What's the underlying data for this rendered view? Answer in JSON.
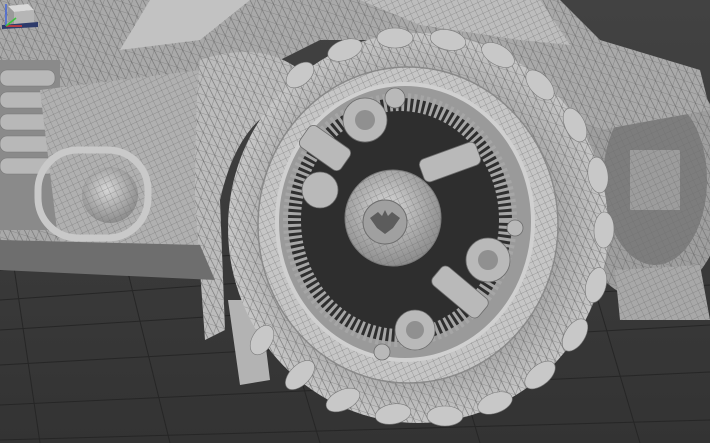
{
  "viewport": {
    "view_mode": "perspective",
    "shading": "wireframe-over-shaded",
    "background_color": "#3b3b3b",
    "mesh_color": "#b5b5b5",
    "wire_color": "#666666",
    "grid_color": "#232323"
  },
  "icons": {
    "viewcube": "viewcube-icon",
    "axis_tripod": "axis-tripod-icon",
    "hub_emblem": "bat-emblem-icon"
  },
  "axis_colors": {
    "x": "#d23c3c",
    "y": "#3cc43c",
    "z": "#4a6ad8"
  }
}
